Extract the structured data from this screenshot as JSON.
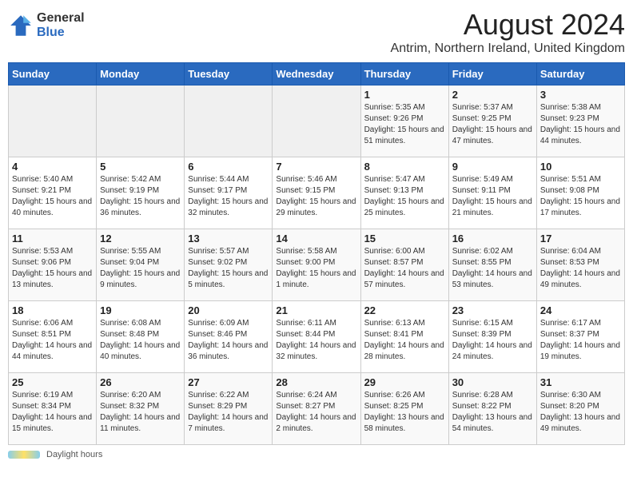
{
  "header": {
    "logo": {
      "general": "General",
      "blue": "Blue"
    },
    "title": "August 2024",
    "subtitle": "Antrim, Northern Ireland, United Kingdom"
  },
  "calendar": {
    "columns": [
      "Sunday",
      "Monday",
      "Tuesday",
      "Wednesday",
      "Thursday",
      "Friday",
      "Saturday"
    ],
    "weeks": [
      [
        {
          "day": "",
          "detail": ""
        },
        {
          "day": "",
          "detail": ""
        },
        {
          "day": "",
          "detail": ""
        },
        {
          "day": "",
          "detail": ""
        },
        {
          "day": "1",
          "detail": "Sunrise: 5:35 AM\nSunset: 9:26 PM\nDaylight: 15 hours and 51 minutes."
        },
        {
          "day": "2",
          "detail": "Sunrise: 5:37 AM\nSunset: 9:25 PM\nDaylight: 15 hours and 47 minutes."
        },
        {
          "day": "3",
          "detail": "Sunrise: 5:38 AM\nSunset: 9:23 PM\nDaylight: 15 hours and 44 minutes."
        }
      ],
      [
        {
          "day": "4",
          "detail": "Sunrise: 5:40 AM\nSunset: 9:21 PM\nDaylight: 15 hours and 40 minutes."
        },
        {
          "day": "5",
          "detail": "Sunrise: 5:42 AM\nSunset: 9:19 PM\nDaylight: 15 hours and 36 minutes."
        },
        {
          "day": "6",
          "detail": "Sunrise: 5:44 AM\nSunset: 9:17 PM\nDaylight: 15 hours and 32 minutes."
        },
        {
          "day": "7",
          "detail": "Sunrise: 5:46 AM\nSunset: 9:15 PM\nDaylight: 15 hours and 29 minutes."
        },
        {
          "day": "8",
          "detail": "Sunrise: 5:47 AM\nSunset: 9:13 PM\nDaylight: 15 hours and 25 minutes."
        },
        {
          "day": "9",
          "detail": "Sunrise: 5:49 AM\nSunset: 9:11 PM\nDaylight: 15 hours and 21 minutes."
        },
        {
          "day": "10",
          "detail": "Sunrise: 5:51 AM\nSunset: 9:08 PM\nDaylight: 15 hours and 17 minutes."
        }
      ],
      [
        {
          "day": "11",
          "detail": "Sunrise: 5:53 AM\nSunset: 9:06 PM\nDaylight: 15 hours and 13 minutes."
        },
        {
          "day": "12",
          "detail": "Sunrise: 5:55 AM\nSunset: 9:04 PM\nDaylight: 15 hours and 9 minutes."
        },
        {
          "day": "13",
          "detail": "Sunrise: 5:57 AM\nSunset: 9:02 PM\nDaylight: 15 hours and 5 minutes."
        },
        {
          "day": "14",
          "detail": "Sunrise: 5:58 AM\nSunset: 9:00 PM\nDaylight: 15 hours and 1 minute."
        },
        {
          "day": "15",
          "detail": "Sunrise: 6:00 AM\nSunset: 8:57 PM\nDaylight: 14 hours and 57 minutes."
        },
        {
          "day": "16",
          "detail": "Sunrise: 6:02 AM\nSunset: 8:55 PM\nDaylight: 14 hours and 53 minutes."
        },
        {
          "day": "17",
          "detail": "Sunrise: 6:04 AM\nSunset: 8:53 PM\nDaylight: 14 hours and 49 minutes."
        }
      ],
      [
        {
          "day": "18",
          "detail": "Sunrise: 6:06 AM\nSunset: 8:51 PM\nDaylight: 14 hours and 44 minutes."
        },
        {
          "day": "19",
          "detail": "Sunrise: 6:08 AM\nSunset: 8:48 PM\nDaylight: 14 hours and 40 minutes."
        },
        {
          "day": "20",
          "detail": "Sunrise: 6:09 AM\nSunset: 8:46 PM\nDaylight: 14 hours and 36 minutes."
        },
        {
          "day": "21",
          "detail": "Sunrise: 6:11 AM\nSunset: 8:44 PM\nDaylight: 14 hours and 32 minutes."
        },
        {
          "day": "22",
          "detail": "Sunrise: 6:13 AM\nSunset: 8:41 PM\nDaylight: 14 hours and 28 minutes."
        },
        {
          "day": "23",
          "detail": "Sunrise: 6:15 AM\nSunset: 8:39 PM\nDaylight: 14 hours and 24 minutes."
        },
        {
          "day": "24",
          "detail": "Sunrise: 6:17 AM\nSunset: 8:37 PM\nDaylight: 14 hours and 19 minutes."
        }
      ],
      [
        {
          "day": "25",
          "detail": "Sunrise: 6:19 AM\nSunset: 8:34 PM\nDaylight: 14 hours and 15 minutes."
        },
        {
          "day": "26",
          "detail": "Sunrise: 6:20 AM\nSunset: 8:32 PM\nDaylight: 14 hours and 11 minutes."
        },
        {
          "day": "27",
          "detail": "Sunrise: 6:22 AM\nSunset: 8:29 PM\nDaylight: 14 hours and 7 minutes."
        },
        {
          "day": "28",
          "detail": "Sunrise: 6:24 AM\nSunset: 8:27 PM\nDaylight: 14 hours and 2 minutes."
        },
        {
          "day": "29",
          "detail": "Sunrise: 6:26 AM\nSunset: 8:25 PM\nDaylight: 13 hours and 58 minutes."
        },
        {
          "day": "30",
          "detail": "Sunrise: 6:28 AM\nSunset: 8:22 PM\nDaylight: 13 hours and 54 minutes."
        },
        {
          "day": "31",
          "detail": "Sunrise: 6:30 AM\nSunset: 8:20 PM\nDaylight: 13 hours and 49 minutes."
        }
      ]
    ]
  },
  "footer": {
    "daylight_label": "Daylight hours"
  }
}
